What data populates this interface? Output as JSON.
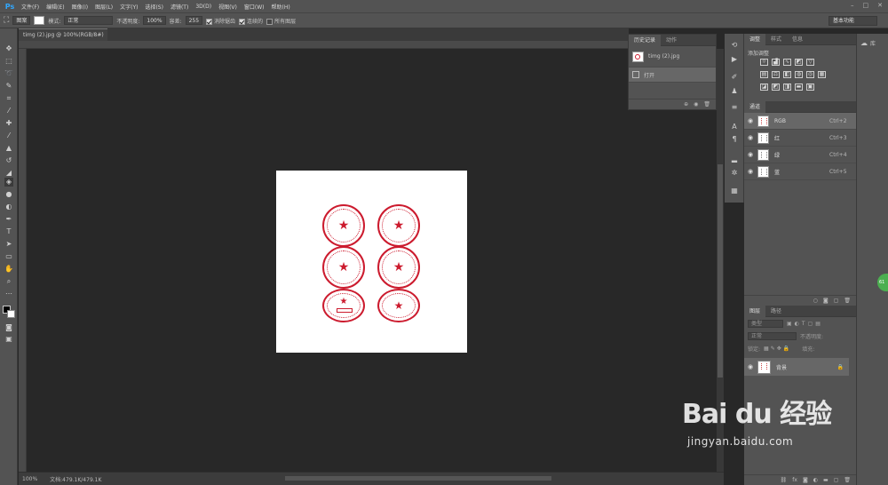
{
  "app": {
    "logo": "Ps",
    "doc_tab": "timg (2).jpg @ 100%(RGB/8#)",
    "tab_close": "×"
  },
  "menu": [
    "文件(F)",
    "编辑(E)",
    "图像(I)",
    "图层(L)",
    "文字(Y)",
    "选择(S)",
    "滤镜(T)",
    "3D(D)",
    "视图(V)",
    "窗口(W)",
    "帮助(H)"
  ],
  "options": {
    "mode_label": "图案",
    "style_label": "模式:",
    "mode_value": "正常",
    "opacity_label": "不透明度:",
    "opacity_value": "100%",
    "tolerance_label": "容差:",
    "tolerance_value": "255",
    "antialias": "消除锯齿",
    "contiguous": "连续的",
    "all_layers": "所有图层",
    "workspace": "基本功能"
  },
  "status": {
    "zoom": "100%",
    "doc": "文档:479.1K/479.1K"
  },
  "history": {
    "tabs": [
      "历史记录",
      "动作"
    ],
    "items": [
      {
        "label": "timg (2).jpg"
      },
      {
        "label": "打开"
      }
    ]
  },
  "adjustments": {
    "tabs": [
      "调整",
      "样式",
      "信息"
    ],
    "add_label": "添加调整"
  },
  "channels": {
    "tab": "通道",
    "rows": [
      {
        "name": "RGB",
        "key": "Ctrl+2"
      },
      {
        "name": "红",
        "key": "Ctrl+3"
      },
      {
        "name": "绿",
        "key": "Ctrl+4"
      },
      {
        "name": "蓝",
        "key": "Ctrl+5"
      }
    ]
  },
  "layers": {
    "tabs": [
      "图层",
      "路径"
    ],
    "kind": "类型",
    "blend": "正常",
    "opacity_label": "不透明度:",
    "lock_label": "锁定:",
    "fill_label": "填充:",
    "layer_name": "背景"
  },
  "library": {
    "label": "库"
  },
  "watermark": {
    "logo": "Bai du 经验",
    "url": "jingyan.baidu.com"
  },
  "badge": "61",
  "colors": {
    "stamp_red": "#cc1b2e",
    "ui_bg": "#535353",
    "canvas_bg": "#282828"
  }
}
